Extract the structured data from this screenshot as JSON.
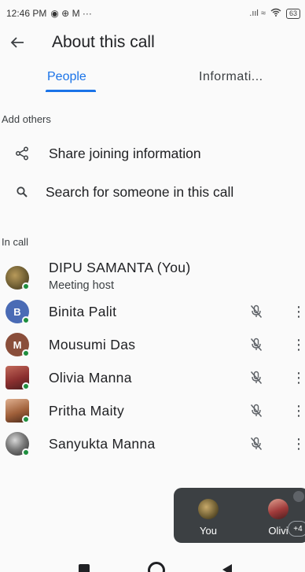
{
  "status_bar": {
    "time": "12:46 PM",
    "indicators": "◉ ⊕ M ···",
    "signal": ".ııl ≈",
    "battery": "63"
  },
  "header": {
    "title": "About this call"
  },
  "tabs": {
    "people": "People",
    "information": "Informati..."
  },
  "add_others": {
    "label": "Add others",
    "share": "Share joining information",
    "search": "Search for someone in this call"
  },
  "in_call": {
    "label": "In call",
    "participants": [
      {
        "name": "DIPU SAMANTA (You)",
        "subtitle": "Meeting host",
        "avatar": "photo",
        "avatar_color": "#7a6a3a"
      },
      {
        "name": "Binita Palit",
        "avatar": "B",
        "avatar_color": "#4a6bb5"
      },
      {
        "name": "Mousumi Das",
        "avatar": "M",
        "avatar_color": "#8a4e3a"
      },
      {
        "name": "Olivia Manna",
        "avatar": "photo",
        "avatar_color": "#9b3a3a"
      },
      {
        "name": "Pritha Maity",
        "avatar": "photo",
        "avatar_color": "#a0603a"
      },
      {
        "name": "Sanyukta Manna",
        "avatar": "photo",
        "avatar_color": "#4a4a4a"
      }
    ]
  },
  "tiles": {
    "you": "You",
    "olivia": "Olivi",
    "more": "+4"
  },
  "colors": {
    "accent": "#1a73e8",
    "online": "#1e8e3e",
    "tile_bg": "#3c4043"
  }
}
